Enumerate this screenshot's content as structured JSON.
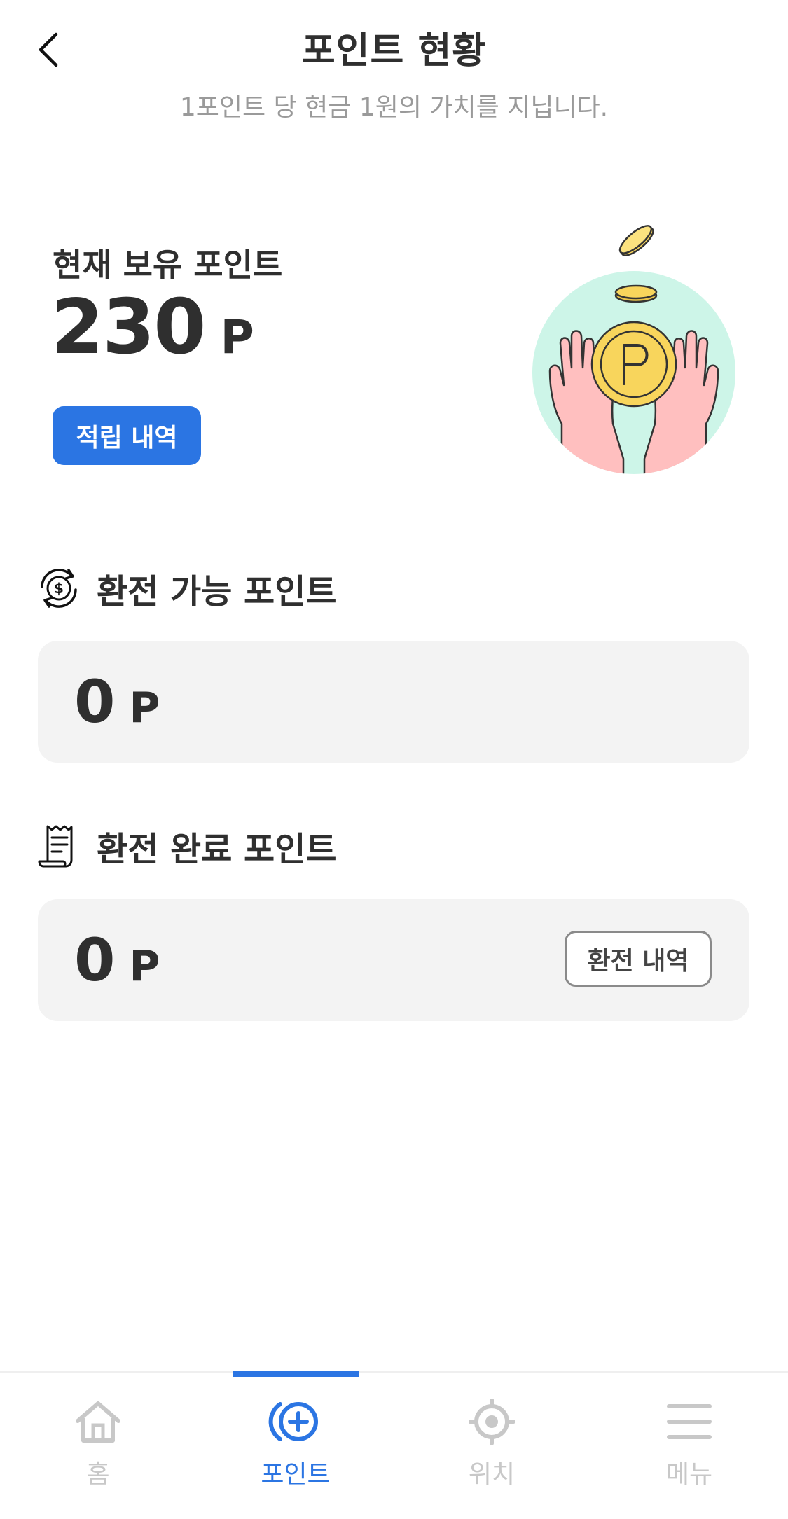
{
  "header": {
    "title": "포인트 현황",
    "subtitle": "1포인트 당 현금 1원의 가치를 지닙니다.",
    "back_icon": "chevron-left-icon"
  },
  "current_points": {
    "label": "현재 보유 포인트",
    "value": "230",
    "unit": "P",
    "history_button": "적립 내역",
    "illustration": "hands-holding-point-coin"
  },
  "exchangeable": {
    "icon": "currency-exchange-icon",
    "title": "환전 가능 포인트",
    "value": "0",
    "unit": "P"
  },
  "exchanged": {
    "icon": "receipt-icon",
    "title": "환전 완료 포인트",
    "value": "0",
    "unit": "P",
    "history_button": "환전 내역"
  },
  "bottom_nav": {
    "items": [
      {
        "label": "홈",
        "icon": "home-icon",
        "active": false
      },
      {
        "label": "포인트",
        "icon": "point-plus-icon",
        "active": true
      },
      {
        "label": "위치",
        "icon": "location-target-icon",
        "active": false
      },
      {
        "label": "메뉴",
        "icon": "menu-icon",
        "active": false
      }
    ]
  },
  "colors": {
    "accent": "#2b75e3",
    "text": "#2f2f2f",
    "subtext": "#9a9a9a",
    "card_bg": "#f3f3f3",
    "nav_inactive": "#c8c8c8",
    "illustration_bg": "#cdf5e8",
    "coin": "#f8d55c",
    "hand": "#ffbfbf"
  }
}
